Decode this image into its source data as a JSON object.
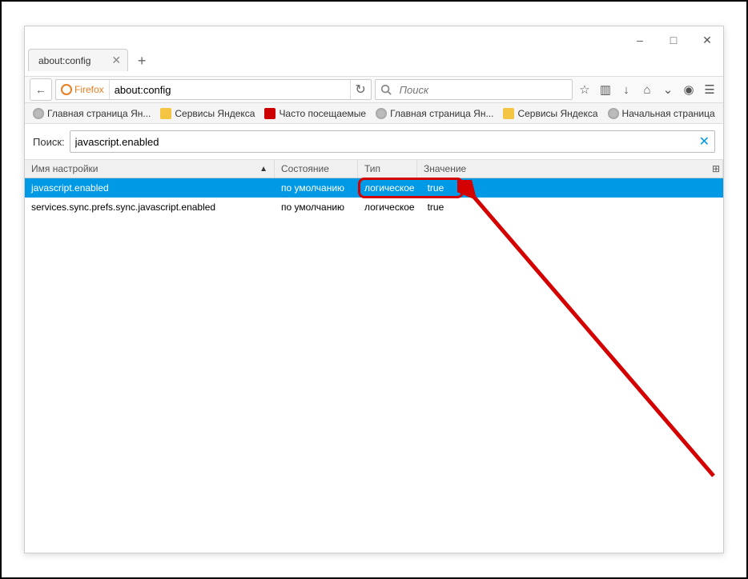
{
  "window": {
    "tab_title": "about:config",
    "minimize": "–",
    "maximize": "□",
    "close": "✕"
  },
  "toolbar": {
    "identity": "Firefox",
    "url": "about:config",
    "search_placeholder": "Поиск"
  },
  "bookmarks": [
    {
      "label": "Главная страница Ян...",
      "icon": "globe"
    },
    {
      "label": "Сервисы Яндекса",
      "icon": "folder"
    },
    {
      "label": "Часто посещаемые",
      "icon": "ya"
    },
    {
      "label": "Главная страница Ян...",
      "icon": "globe"
    },
    {
      "label": "Сервисы Яндекса",
      "icon": "folder"
    },
    {
      "label": "Начальная страница",
      "icon": "globe"
    }
  ],
  "config": {
    "search_label": "Поиск:",
    "search_value": "javascript.enabled",
    "columns": {
      "name": "Имя настройки",
      "status": "Состояние",
      "type": "Тип",
      "value": "Значение"
    },
    "rows": [
      {
        "name": "javascript.enabled",
        "status": "по умолчанию",
        "type": "логическое",
        "value": "true",
        "selected": true
      },
      {
        "name": "services.sync.prefs.sync.javascript.enabled",
        "status": "по умолчанию",
        "type": "логическое",
        "value": "true",
        "selected": false
      }
    ]
  }
}
